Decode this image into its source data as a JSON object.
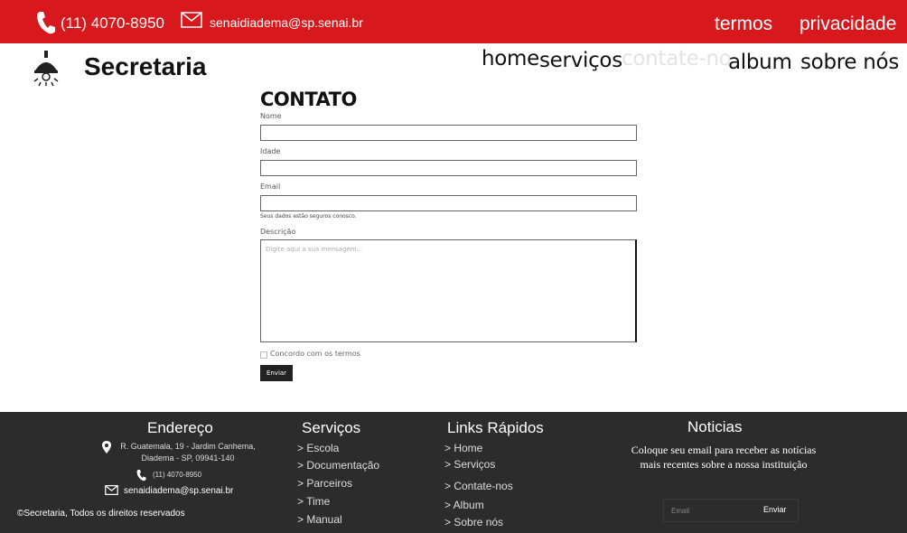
{
  "topbar": {
    "phone": "(11) 4070-8950",
    "email": "senaidiadema@sp.senai.br",
    "links": {
      "termos": "termos",
      "privacidade": "privacidade"
    }
  },
  "header": {
    "brand": "Secretaria",
    "nav": {
      "home": "home",
      "servicos": "serviços",
      "contate": "contate-no",
      "album": "album",
      "sobre": "sobre nós"
    }
  },
  "form": {
    "title": "CONTATO",
    "name_label": "Nome",
    "age_label": "Idade",
    "email_label": "Email",
    "email_hint": "Seus dados estão seguros conosco.",
    "desc_label": "Descrição",
    "desc_placeholder": "Digite aqui a sua mensagem...",
    "agree_label": "Concordo com os termos",
    "submit_label": "Enviar"
  },
  "footer": {
    "address_title": "Endereço",
    "address_line1": "R. Guatemala, 19 - Jardim Canhema,",
    "address_line2": "Diadema - SP, 09941-140",
    "phone": "(11) 4070-8950",
    "email": "senaidiadema@sp.senai.br",
    "services_title": "Serviços",
    "services": [
      "> Escola",
      "> Documentação",
      "> Parceiros",
      "> Time",
      "> Manual"
    ],
    "quick_title": "Links Rápidos",
    "quick_links": [
      "> Home",
      "> Serviços",
      "> Contate-nos",
      "> Album",
      "> Sobre nós"
    ],
    "news_title": "Noticias",
    "news_text": "Coloque seu email para receber as notícias mais recentes sobre a nossa instituição",
    "news_placeholder": "Email",
    "news_button": "Enviar",
    "copyright": "©Secretaria, Todos os direitos reservados"
  }
}
